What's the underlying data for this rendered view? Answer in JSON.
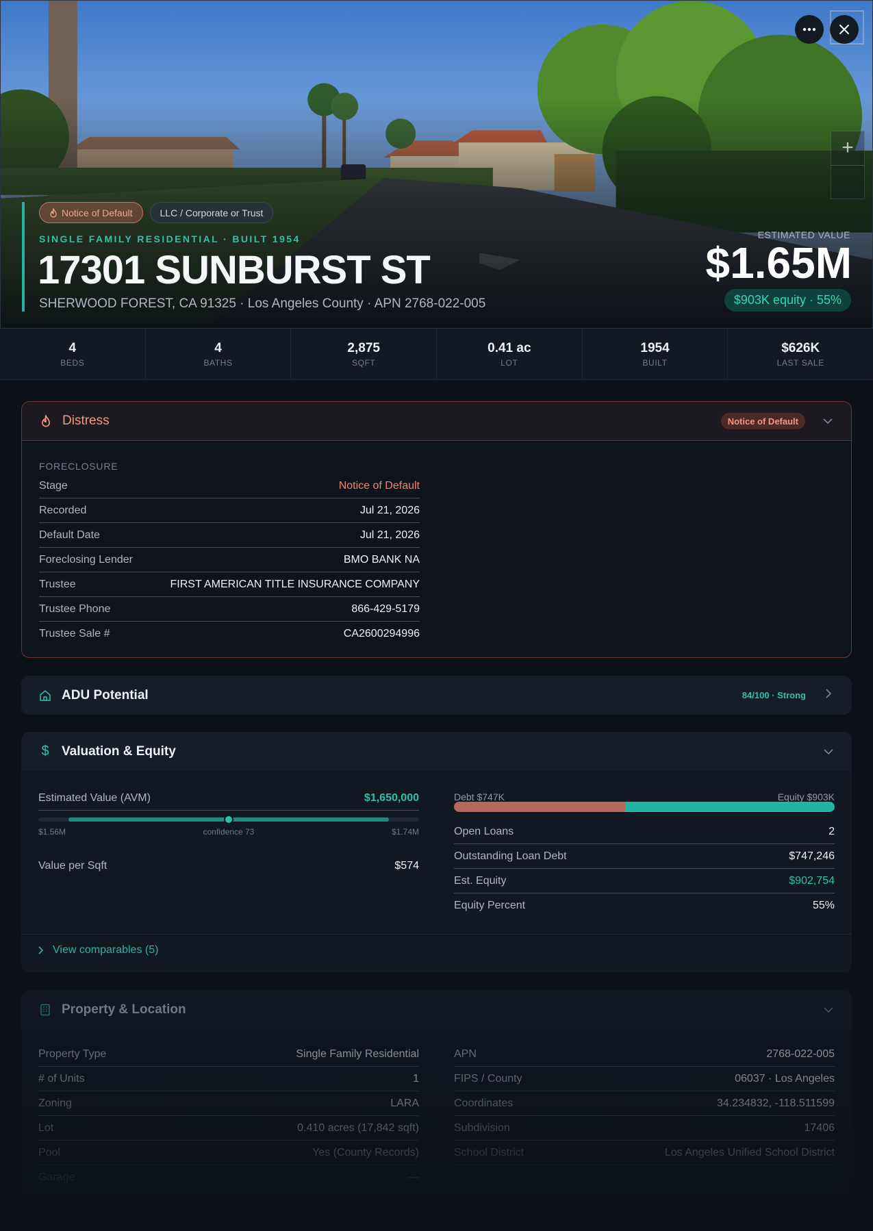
{
  "hero": {
    "chips": {
      "distress": "Notice of Default",
      "owner_type": "LLC / Corporate or Trust"
    },
    "subline": "SINGLE FAMILY RESIDENTIAL · BUILT 1954",
    "address": "17301 SUNBURST ST",
    "location": "SHERWOOD FOREST, CA 91325 · Los Angeles County · APN 2768-022-005",
    "estimated_value_label": "ESTIMATED VALUE",
    "estimated_value": "$1.65M",
    "equity_pill": "$903K equity · 55%",
    "icons": {
      "more": "more-icon",
      "close": "close-icon",
      "zoom_in": "plus-icon"
    }
  },
  "stats": [
    {
      "value": "4",
      "label": "BEDS"
    },
    {
      "value": "4",
      "label": "BATHS"
    },
    {
      "value": "2,875",
      "label": "SQFT"
    },
    {
      "value": "0.41 ac",
      "label": "LOT"
    },
    {
      "value": "1954",
      "label": "BUILT"
    },
    {
      "value": "$626K",
      "label": "LAST SALE"
    }
  ],
  "distress": {
    "title": "Distress",
    "badge": "Notice of Default",
    "section": "FORECLOSURE",
    "rows": [
      {
        "k": "Stage",
        "v": "Notice of Default"
      },
      {
        "k": "Recorded",
        "v": "Jul 21, 2026"
      },
      {
        "k": "Default Date",
        "v": "Jul 21, 2026"
      },
      {
        "k": "Foreclosing Lender",
        "v": "BMO BANK NA"
      },
      {
        "k": "Trustee",
        "v": "FIRST AMERICAN TITLE INSURANCE COMPANY"
      },
      {
        "k": "Trustee Phone",
        "v": "866-429-5179"
      },
      {
        "k": "Trustee Sale #",
        "v": "CA2600294996"
      }
    ]
  },
  "adu": {
    "title": "ADU Potential",
    "score": "84/100 · Strong"
  },
  "valuation": {
    "title": "Valuation & Equity",
    "avm_label": "Estimated Value (AVM)",
    "avm_value": "$1,650,000",
    "range_low": "$1.56M",
    "range_high": "$1.74M",
    "confidence": "confidence 73",
    "range_fill": {
      "start": 0.08,
      "end": 0.92,
      "point": 0.5
    },
    "value_per_sqft_label": "Value per Sqft",
    "value_per_sqft": "$574",
    "debt_label": "Debt $747K",
    "equity_label": "Equity $903K",
    "debt_fraction": 0.45,
    "rows": [
      {
        "k": "Open Loans",
        "v": "2"
      },
      {
        "k": "Outstanding Loan Debt",
        "v": "$747,246"
      },
      {
        "k": "Est. Equity",
        "v": "$902,754"
      },
      {
        "k": "Equity Percent",
        "v": "55%"
      }
    ],
    "comparables_link": "View comparables (5)"
  },
  "property": {
    "title": "Property & Location",
    "left": [
      {
        "k": "Property Type",
        "v": "Single Family Residential"
      },
      {
        "k": "# of Units",
        "v": "1"
      },
      {
        "k": "Zoning",
        "v": "LARA"
      },
      {
        "k": "Lot",
        "v": "0.410 acres (17,842 sqft)"
      },
      {
        "k": "Pool",
        "v": "Yes (County Records)"
      },
      {
        "k": "Garage",
        "v": "—"
      }
    ],
    "right": [
      {
        "k": "APN",
        "v": "2768-022-005"
      },
      {
        "k": "FIPS / County",
        "v": "06037 · Los Angeles"
      },
      {
        "k": "Coordinates",
        "v": "34.234832, -118.511599"
      },
      {
        "k": "Subdivision",
        "v": "17406"
      },
      {
        "k": "School District",
        "v": "Los Angeles Unified School District"
      }
    ]
  },
  "colors": {
    "accent": "#2fc0ac",
    "distress": "#f29883",
    "debt": "#b7665c",
    "equity": "#20b5a3"
  }
}
